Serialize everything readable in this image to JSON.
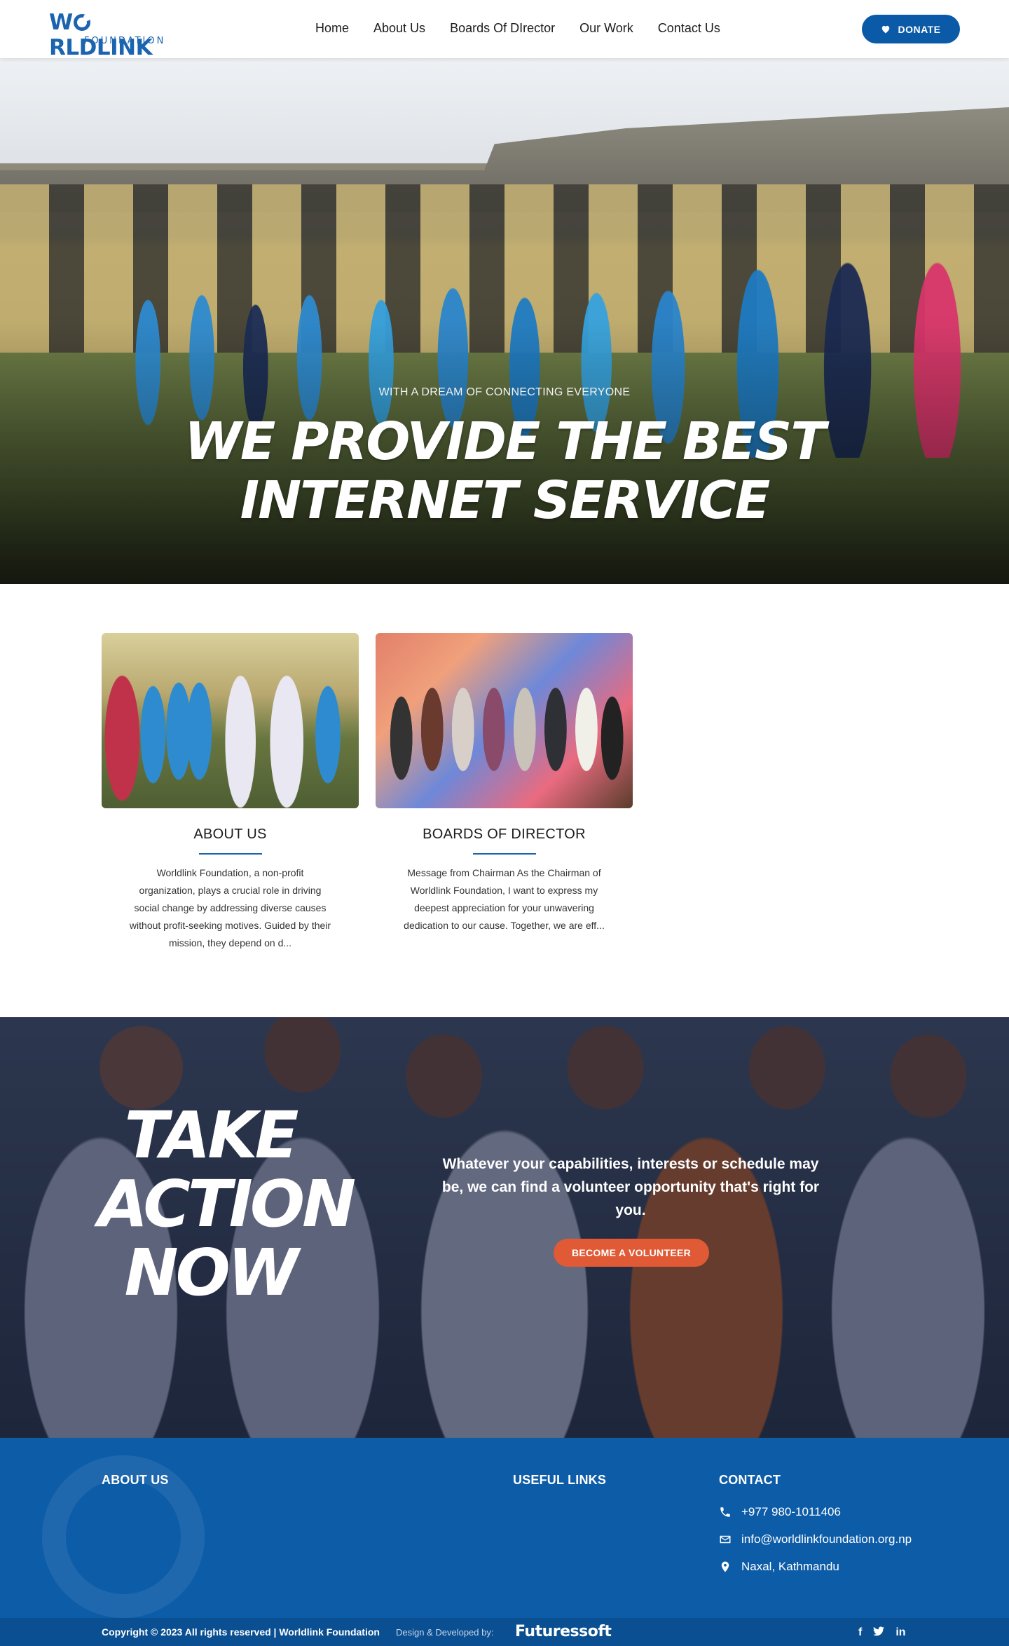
{
  "header": {
    "logo_word": "WORLDLINK",
    "logo_sub": "FOUNDATION",
    "nav": [
      "Home",
      "About Us",
      "Boards Of DIrector",
      "Our Work",
      "Contact Us"
    ],
    "donate_label": "DONATE"
  },
  "hero": {
    "kicker": "WITH A DREAM OF CONNECTING EVERYONE",
    "title_line1": "WE PROVIDE THE BEST",
    "title_line2": "INTERNET SERVICE"
  },
  "cards": [
    {
      "title": "ABOUT US",
      "text": "Worldlink Foundation, a non-profit organization, plays a crucial role in driving social change by addressing diverse causes without profit-seeking motives. Guided by their mission, they depend on d..."
    },
    {
      "title": "BOARDS OF DIRECTOR",
      "text": "Message from Chairman As the Chairman of Worldlink Foundation, I want to express my deepest appreciation for your unwavering dedication to our cause. Together, we are eff..."
    }
  ],
  "cta": {
    "title_line1": "TAKE",
    "title_line2": "ACTION",
    "title_line3": "NOW",
    "text": "Whatever your capabilities, interests or schedule may be, we can find a volunteer opportunity that's right for you.",
    "button": "BECOME A VOLUNTEER"
  },
  "footer": {
    "about_heading": "ABOUT US",
    "links_heading": "USEFUL LINKS",
    "contact_heading": "CONTACT",
    "phone": "+977 980-1011406",
    "email": "info@worldlinkfoundation.org.np",
    "address": "Naxal, Kathmandu",
    "copyright": "Copyright © 2023 All rights reserved | Worldlink Foundation",
    "design_credit": "Design & Developed by:",
    "developer": "Futuressoft",
    "social": [
      "f",
      "t",
      "in"
    ]
  },
  "colors": {
    "brand_blue": "#0b5aa8",
    "cta_orange": "#e05a35",
    "footer_blue": "#0d5ca8"
  }
}
